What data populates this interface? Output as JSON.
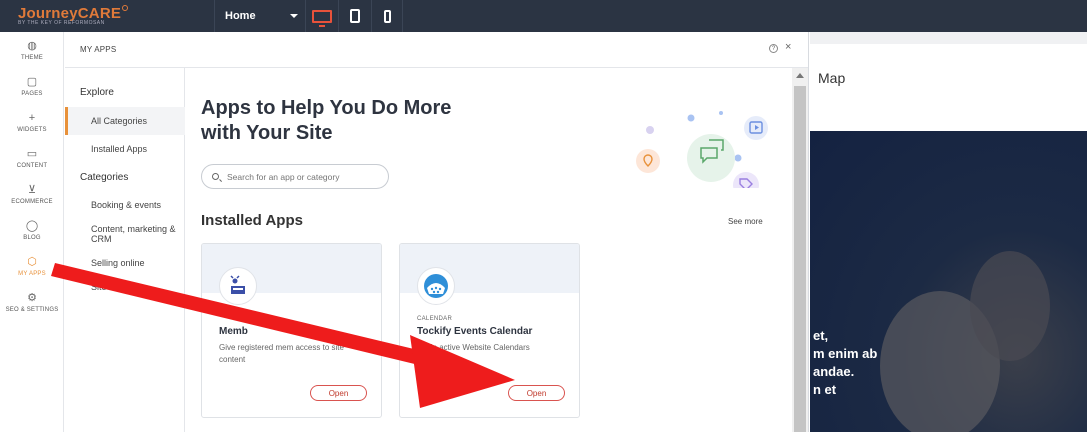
{
  "topbar": {
    "logo_text": "JourneyCARE",
    "logo_sub": "BY THE KEY OF REFORMOSAN",
    "page_select": "Home"
  },
  "rail": {
    "items": [
      {
        "icon": "◍",
        "label": "THEME"
      },
      {
        "icon": "▢",
        "label": "PAGES"
      },
      {
        "icon": "+",
        "label": "WIDGETS"
      },
      {
        "icon": "▭",
        "label": "CONTENT"
      },
      {
        "icon": "⊻",
        "label": "ECOMMERCE"
      },
      {
        "icon": "◯",
        "label": "BLOG"
      },
      {
        "icon": "⬡",
        "label": "MY APPS"
      },
      {
        "icon": "⚙",
        "label": "SEO & SETTINGS"
      }
    ]
  },
  "modal": {
    "title": "MY APPS",
    "help": "?",
    "close": "×"
  },
  "explore": {
    "heading": "Explore",
    "all_categories": "All Categories",
    "installed_apps": "Installed Apps",
    "categories_heading": "Categories",
    "categories": [
      "Booking & events",
      "Content, marketing & CRM",
      "Selling online",
      "Site el"
    ]
  },
  "content": {
    "hero_title": "Apps to Help You Do More with Your Site",
    "search_placeholder": "Search for an app or category",
    "installed_title": "Installed Apps",
    "see_more": "See more"
  },
  "cards": [
    {
      "category": "",
      "name": "Memb",
      "description": "Give registered mem access to site content",
      "button": "Open"
    },
    {
      "category": "CALENDAR",
      "name": "Tockify Events Calendar",
      "description": "Mode      active Website Calendars",
      "button": "Open"
    }
  ],
  "preview": {
    "nav_item": "Map",
    "text_lines": [
      "et,",
      "m enim ab",
      "andae.",
      "n et"
    ]
  },
  "colors": {
    "topbar": "#2b3443",
    "accent": "#e8913a",
    "danger": "#e8523b",
    "arrow": "#ee1c1c"
  }
}
